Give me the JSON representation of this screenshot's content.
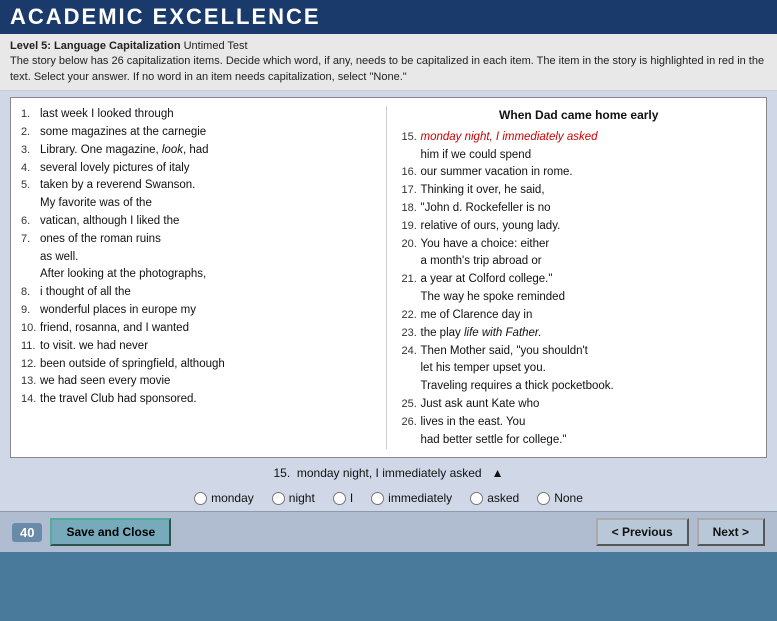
{
  "header": {
    "title": "ACADEMIC EXCELLENCE"
  },
  "instruction": {
    "level_label": "Level 5:",
    "skill": "Language Capitalization",
    "mode": "Untimed Test",
    "directions": "Decide which word, if any, needs to be capitalized in each item. The item in the story below has 26 capitalization items. Decide which word, if any, needs to be capitalized in each item. The item in the story is highlighted in red in the text. Select your answer. If no word in an item needs capitalization, select \"None.\""
  },
  "passage": {
    "title": "When Dad came home early",
    "left_lines": [
      {
        "num": "1.",
        "text": "last week I looked through"
      },
      {
        "num": "2.",
        "text": "some magazines at the carnegie"
      },
      {
        "num": "3.",
        "text": "Library. One magazine, look, had"
      },
      {
        "num": "4.",
        "text": "several lovely pictures of italy"
      },
      {
        "num": "5.",
        "text": "taken by a reverend Swanson."
      },
      {
        "num": "",
        "text": "My favorite was of the"
      },
      {
        "num": "6.",
        "text": "vatican, although I liked the"
      },
      {
        "num": "7.",
        "text": "ones of the roman ruins"
      },
      {
        "num": "",
        "text": "as well."
      },
      {
        "num": "",
        "text": "After looking at the photographs,"
      },
      {
        "num": "8.",
        "text": "i thought of all the"
      },
      {
        "num": "9.",
        "text": "wonderful places in europe my"
      },
      {
        "num": "10.",
        "text": "friend, rosanna, and I wanted"
      },
      {
        "num": "11.",
        "text": "to visit. we had never"
      },
      {
        "num": "12.",
        "text": "been outside of springfield, although"
      },
      {
        "num": "13.",
        "text": "we had seen every movie"
      },
      {
        "num": "14.",
        "text": "the travel Club had sponsored."
      }
    ],
    "right_lines": [
      {
        "num": "15.",
        "text": "monday night, I immediately asked",
        "red": "monday night, I immediately asked"
      },
      {
        "num": "",
        "text": "him if we could spend"
      },
      {
        "num": "16.",
        "text": "our summer vacation in rome."
      },
      {
        "num": "17.",
        "text": "Thinking it over, he said,"
      },
      {
        "num": "18.",
        "text": "\"John d. Rockefeller is no"
      },
      {
        "num": "19.",
        "text": "relative of ours, young lady."
      },
      {
        "num": "20.",
        "text": "You have a choice: either"
      },
      {
        "num": "",
        "text": "a month's trip abroad or"
      },
      {
        "num": "21.",
        "text": "a year at Colford college.\""
      },
      {
        "num": "",
        "text": "The way he spoke reminded"
      },
      {
        "num": "22.",
        "text": "me of Clarence day in"
      },
      {
        "num": "23.",
        "text": "the play life with Father."
      },
      {
        "num": "24.",
        "text": "Then Mother said, \"you shouldn't"
      },
      {
        "num": "",
        "text": "let his temper upset you."
      },
      {
        "num": "",
        "text": "Traveling requires a thick pocketbook."
      },
      {
        "num": "25.",
        "text": "Just ask aunt Kate who"
      },
      {
        "num": "26.",
        "text": "lives in the east. You"
      },
      {
        "num": "",
        "text": "had better settle for college.\""
      }
    ]
  },
  "question": {
    "number": "15.",
    "text": "monday night, I immediately asked"
  },
  "answers": {
    "options": [
      {
        "id": "monday",
        "label": "monday"
      },
      {
        "id": "night",
        "label": "night"
      },
      {
        "id": "I",
        "label": "I"
      },
      {
        "id": "immediately",
        "label": "immediately"
      },
      {
        "id": "asked",
        "label": "asked"
      },
      {
        "id": "None",
        "label": "None"
      }
    ]
  },
  "bottom": {
    "score_label": "40",
    "save_label": "Save and Close",
    "prev_label": "< Previous",
    "next_label": "Next >"
  }
}
